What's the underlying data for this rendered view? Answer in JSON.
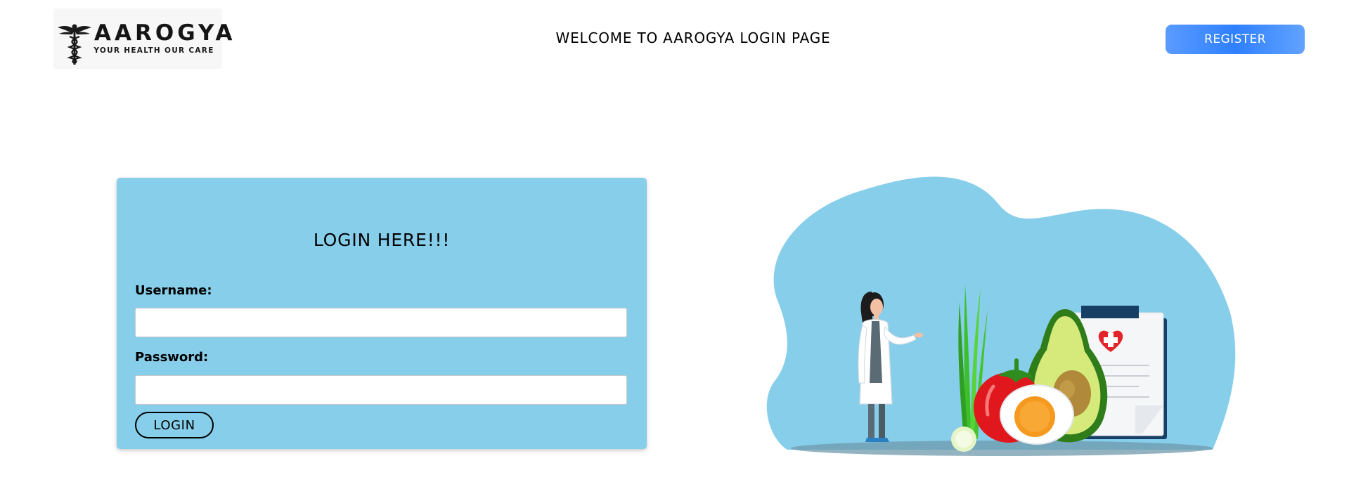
{
  "header": {
    "logo": {
      "title": "AAROGYA",
      "tagline": "YOUR HEALTH OUR CARE",
      "icon": "caduceus-icon"
    },
    "title": "WELCOME TO AAROGYA LOGIN PAGE",
    "register_label": "REGISTER"
  },
  "login_form": {
    "heading": "LOGIN HERE!!!",
    "username_label": "Username:",
    "username_value": "",
    "password_label": "Password:",
    "password_value": "",
    "submit_label": "LOGIN"
  },
  "illustration": {
    "description_icon": "doctor-healthy-food-illustration"
  },
  "colors": {
    "card_background": "#87ceeb",
    "register_button": "#2f80ff",
    "blob": "#87ceeb",
    "page_background": "#ffffff"
  }
}
